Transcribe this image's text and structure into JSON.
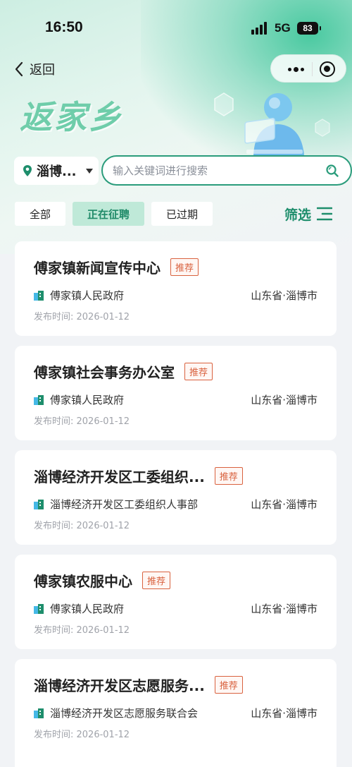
{
  "status_bar": {
    "time": "16:50",
    "network": "5G",
    "battery": "83"
  },
  "nav": {
    "back_label": "返回"
  },
  "banner": {
    "title": "返家乡"
  },
  "search": {
    "location": "淄博...",
    "placeholder": "输入关键词进行搜索"
  },
  "tabs": [
    {
      "label": "全部",
      "active": false
    },
    {
      "label": "正在征聘",
      "active": true
    },
    {
      "label": "已过期",
      "active": false
    }
  ],
  "filter": {
    "label": "筛选"
  },
  "cards": [
    {
      "title": "傅家镇新闻宣传中心",
      "badge": "推荐",
      "org": "傅家镇人民政府",
      "region": "山东省·淄博市",
      "date": "发布时间: 2026-01-12"
    },
    {
      "title": "傅家镇社会事务办公室",
      "badge": "推荐",
      "org": "傅家镇人民政府",
      "region": "山东省·淄博市",
      "date": "发布时间: 2026-01-12"
    },
    {
      "title": "淄博经济开发区工委组织...",
      "badge": "推荐",
      "org": "淄博经济开发区工委组织人事部",
      "region": "山东省·淄博市",
      "date": "发布时间: 2026-01-12"
    },
    {
      "title": "傅家镇农服中心",
      "badge": "推荐",
      "org": "傅家镇人民政府",
      "region": "山东省·淄博市",
      "date": "发布时间: 2026-01-12"
    },
    {
      "title": "淄博经济开发区志愿服务...",
      "badge": "推荐",
      "org": "淄博经济开发区志愿服务联合会",
      "region": "山东省·淄博市",
      "date": "发布时间: 2026-01-12"
    }
  ],
  "colors": {
    "accent": "#1e8e6c",
    "tab_active_bg": "#bfe9d8",
    "badge": "#d9623f",
    "page_bg": "#f1f3f6"
  }
}
